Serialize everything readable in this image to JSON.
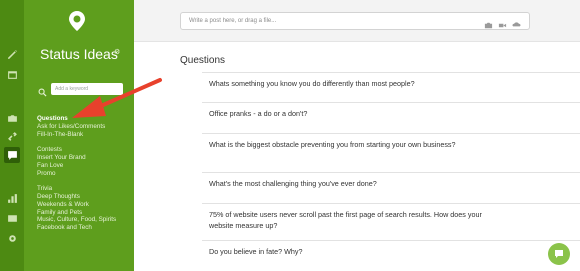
{
  "sidebar": {
    "title": "Status Ideas",
    "keyword_placeholder": "Add a keyword",
    "categories": [
      "Questions",
      "Ask for Likes/Comments",
      "Fill-In-The-Blank",
      "",
      "Contests",
      "Insert Your Brand",
      "Fan Love",
      "Promo",
      "",
      "Trivia",
      "Deep Thoughts",
      "Weekends & Work",
      "Family and Pets",
      "Music, Culture, Food, Spirits",
      "Facebook and Tech"
    ],
    "active_category": "Questions"
  },
  "composer": {
    "placeholder": "Write a post here, or drag a file..."
  },
  "main": {
    "heading": "Questions",
    "questions": [
      "Whats something you know you do differently than most people?",
      "Office pranks - a do or a don't?",
      "What is the biggest obstacle preventing you from starting your own business?",
      "What's the most challenging thing you've ever done?",
      "75% of website users never scroll past the first page of search results. How does your website measure up?",
      "Do you believe in fate? Why?"
    ]
  },
  "colors": {
    "rail": "#4d8a12",
    "panel": "#5e9e1d",
    "arrow": "#e8412c",
    "chat": "#8bc34a"
  },
  "icons": [
    "pencil-icon",
    "calendar-icon",
    "camera-icon",
    "link-icon",
    "chat-icon",
    "bar-chart-icon",
    "image-icon",
    "gear-icon",
    "search-icon",
    "video-icon",
    "upload-icon",
    "location-logo-icon"
  ]
}
